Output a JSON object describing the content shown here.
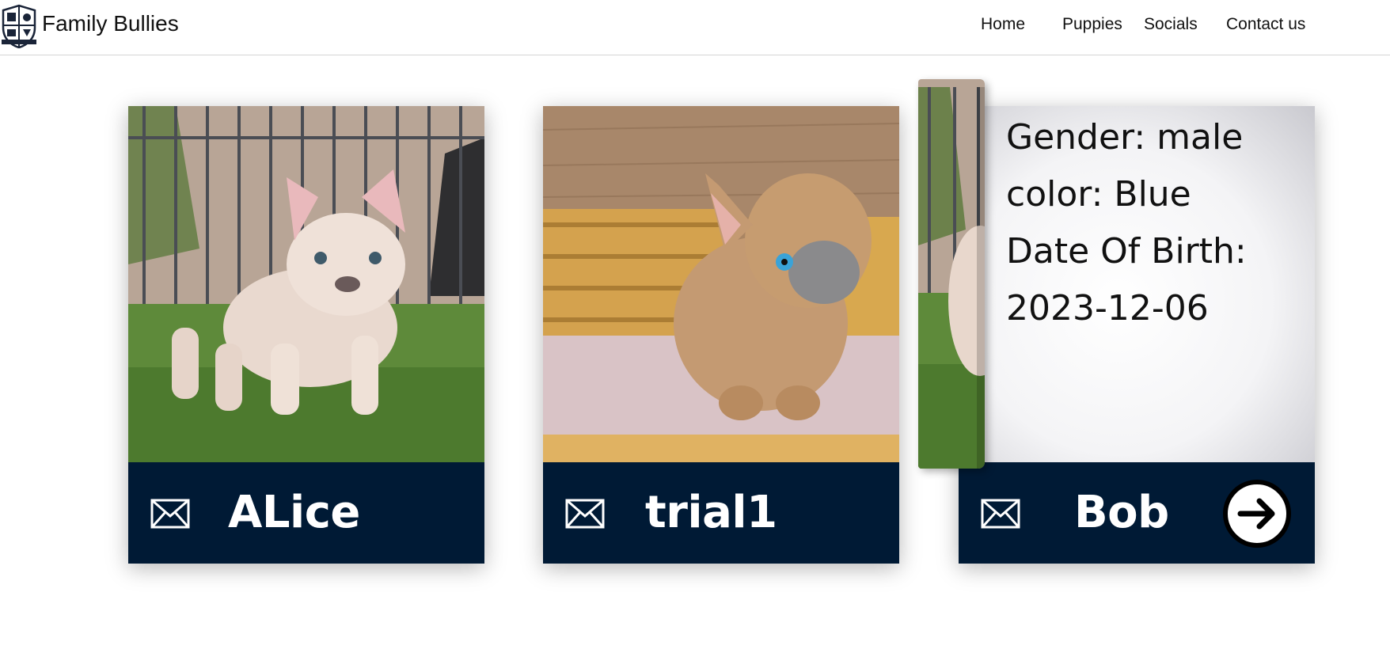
{
  "header": {
    "brand": "Family Bullies",
    "nav": [
      "Home",
      "Puppies",
      "Socials",
      "Contact us"
    ]
  },
  "cards": [
    {
      "name": "ALice",
      "icon": "mail-icon",
      "photo": "cream french bulldog puppy on grass"
    },
    {
      "name": "trial1",
      "icon": "mail-icon",
      "photo": "fawn french bulldog puppy in basket"
    },
    {
      "name": "Bob",
      "icon": "mail-icon",
      "details": [
        "Gender: male",
        "color: Blue",
        "Date Of Birth:",
        "2023-12-06"
      ],
      "action_icon": "arrow-right-icon"
    }
  ],
  "colors": {
    "card_bar": "#001a35",
    "accent_white": "#ffffff"
  }
}
